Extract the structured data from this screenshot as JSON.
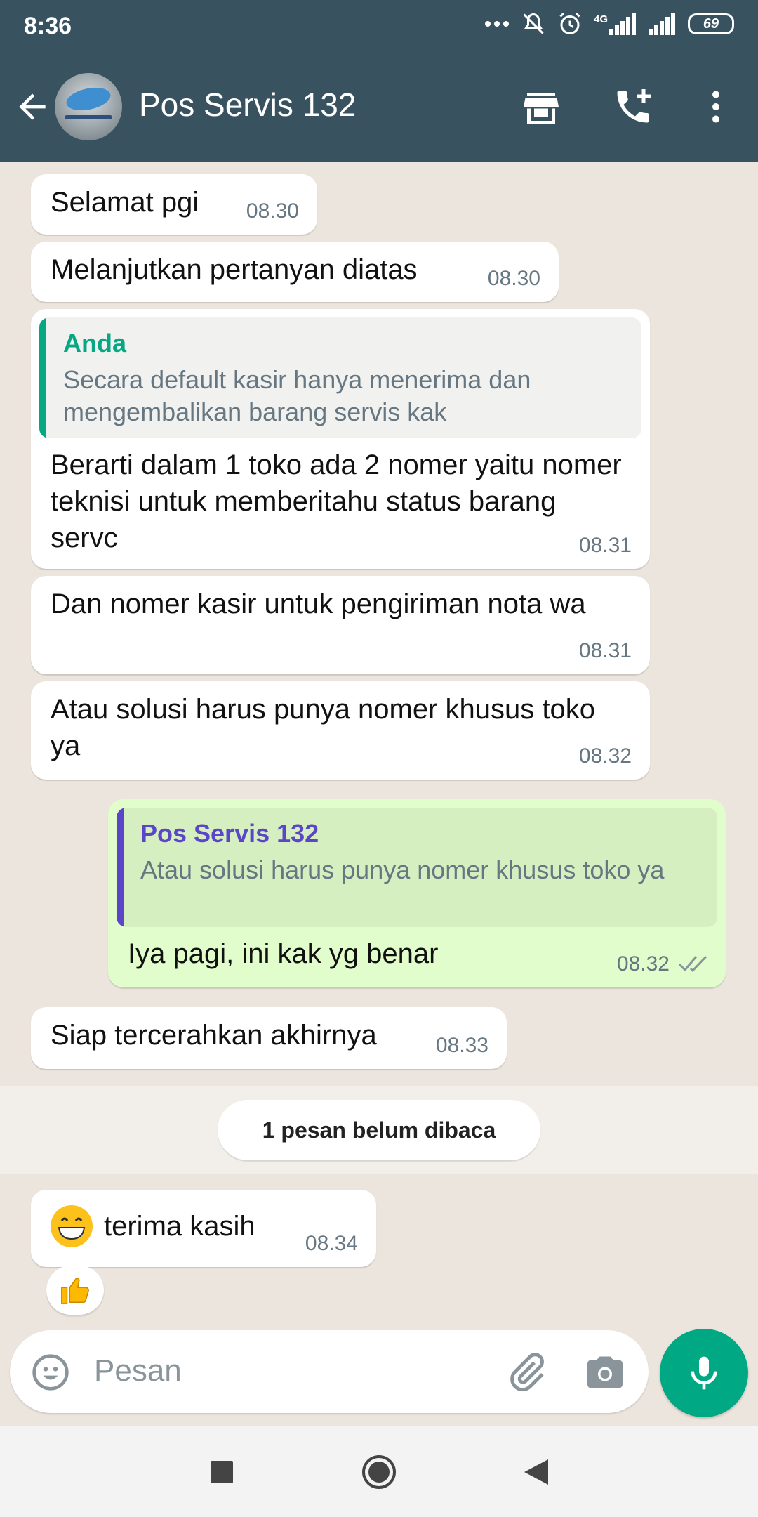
{
  "status_bar": {
    "time": "8:36",
    "network": "4G",
    "battery": "69"
  },
  "header": {
    "contact_name": "Pos Servis 132"
  },
  "colors": {
    "header_bg": "#38535f",
    "accent_green": "#00a884",
    "outgoing_bubble": "#e2fdcc",
    "quote_green": "#06a884",
    "quote_purple": "#5b46c8"
  },
  "messages": [
    {
      "text": "Selamat pgi",
      "time": "08.30"
    },
    {
      "text": "Melanjutkan pertanyan diatas",
      "time": "08.30"
    },
    {
      "quote_name": "Anda",
      "quote_text": "Secara default kasir hanya menerima dan mengembalikan barang servis kak",
      "text": "Berarti dalam 1 toko ada 2 nomer yaitu nomer teknisi untuk memberitahu status barang servc",
      "time": "08.31"
    },
    {
      "text": "Dan nomer kasir untuk pengiriman nota wa",
      "time": "08.31"
    },
    {
      "text": "Atau solusi harus punya nomer khusus toko ya",
      "time": "08.32"
    },
    {
      "quote_name": "Pos Servis 132",
      "quote_text": "Atau solusi harus punya nomer khusus toko ya",
      "text": "Iya pagi, ini kak yg benar",
      "time": "08.32",
      "status_icon": "double-check-icon"
    },
    {
      "text": "Siap tercerahkan akhirnya",
      "time": "08.33"
    },
    {
      "text": "terima kasih",
      "time": "08.34",
      "emoji_icon": "grinning-face-icon",
      "reaction_icon": "thumbs-up-icon"
    }
  ],
  "unread_label": "1 pesan belum dibaca",
  "composer": {
    "placeholder": "Pesan"
  }
}
